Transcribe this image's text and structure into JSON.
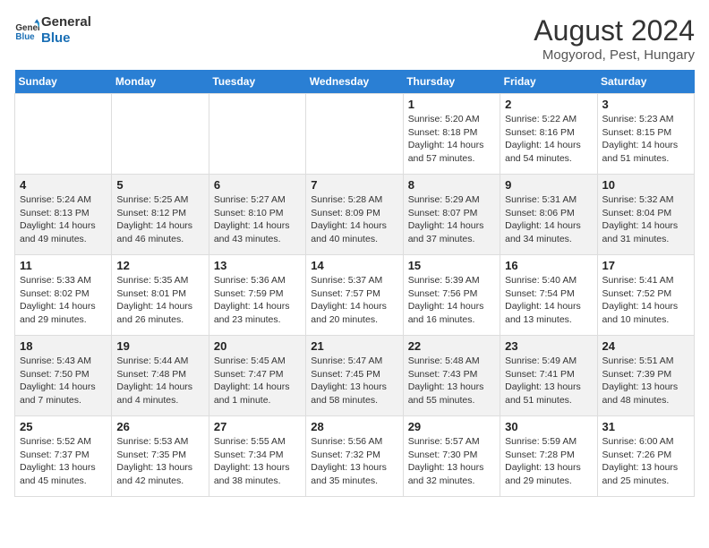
{
  "logo": {
    "text_general": "General",
    "text_blue": "Blue"
  },
  "title": "August 2024",
  "subtitle": "Mogyorod, Pest, Hungary",
  "weekdays": [
    "Sunday",
    "Monday",
    "Tuesday",
    "Wednesday",
    "Thursday",
    "Friday",
    "Saturday"
  ],
  "weeks": [
    [
      {
        "day": "",
        "info": ""
      },
      {
        "day": "",
        "info": ""
      },
      {
        "day": "",
        "info": ""
      },
      {
        "day": "",
        "info": ""
      },
      {
        "day": "1",
        "info": "Sunrise: 5:20 AM\nSunset: 8:18 PM\nDaylight: 14 hours\nand 57 minutes."
      },
      {
        "day": "2",
        "info": "Sunrise: 5:22 AM\nSunset: 8:16 PM\nDaylight: 14 hours\nand 54 minutes."
      },
      {
        "day": "3",
        "info": "Sunrise: 5:23 AM\nSunset: 8:15 PM\nDaylight: 14 hours\nand 51 minutes."
      }
    ],
    [
      {
        "day": "4",
        "info": "Sunrise: 5:24 AM\nSunset: 8:13 PM\nDaylight: 14 hours\nand 49 minutes."
      },
      {
        "day": "5",
        "info": "Sunrise: 5:25 AM\nSunset: 8:12 PM\nDaylight: 14 hours\nand 46 minutes."
      },
      {
        "day": "6",
        "info": "Sunrise: 5:27 AM\nSunset: 8:10 PM\nDaylight: 14 hours\nand 43 minutes."
      },
      {
        "day": "7",
        "info": "Sunrise: 5:28 AM\nSunset: 8:09 PM\nDaylight: 14 hours\nand 40 minutes."
      },
      {
        "day": "8",
        "info": "Sunrise: 5:29 AM\nSunset: 8:07 PM\nDaylight: 14 hours\nand 37 minutes."
      },
      {
        "day": "9",
        "info": "Sunrise: 5:31 AM\nSunset: 8:06 PM\nDaylight: 14 hours\nand 34 minutes."
      },
      {
        "day": "10",
        "info": "Sunrise: 5:32 AM\nSunset: 8:04 PM\nDaylight: 14 hours\nand 31 minutes."
      }
    ],
    [
      {
        "day": "11",
        "info": "Sunrise: 5:33 AM\nSunset: 8:02 PM\nDaylight: 14 hours\nand 29 minutes."
      },
      {
        "day": "12",
        "info": "Sunrise: 5:35 AM\nSunset: 8:01 PM\nDaylight: 14 hours\nand 26 minutes."
      },
      {
        "day": "13",
        "info": "Sunrise: 5:36 AM\nSunset: 7:59 PM\nDaylight: 14 hours\nand 23 minutes."
      },
      {
        "day": "14",
        "info": "Sunrise: 5:37 AM\nSunset: 7:57 PM\nDaylight: 14 hours\nand 20 minutes."
      },
      {
        "day": "15",
        "info": "Sunrise: 5:39 AM\nSunset: 7:56 PM\nDaylight: 14 hours\nand 16 minutes."
      },
      {
        "day": "16",
        "info": "Sunrise: 5:40 AM\nSunset: 7:54 PM\nDaylight: 14 hours\nand 13 minutes."
      },
      {
        "day": "17",
        "info": "Sunrise: 5:41 AM\nSunset: 7:52 PM\nDaylight: 14 hours\nand 10 minutes."
      }
    ],
    [
      {
        "day": "18",
        "info": "Sunrise: 5:43 AM\nSunset: 7:50 PM\nDaylight: 14 hours\nand 7 minutes."
      },
      {
        "day": "19",
        "info": "Sunrise: 5:44 AM\nSunset: 7:48 PM\nDaylight: 14 hours\nand 4 minutes."
      },
      {
        "day": "20",
        "info": "Sunrise: 5:45 AM\nSunset: 7:47 PM\nDaylight: 14 hours\nand 1 minute."
      },
      {
        "day": "21",
        "info": "Sunrise: 5:47 AM\nSunset: 7:45 PM\nDaylight: 13 hours\nand 58 minutes."
      },
      {
        "day": "22",
        "info": "Sunrise: 5:48 AM\nSunset: 7:43 PM\nDaylight: 13 hours\nand 55 minutes."
      },
      {
        "day": "23",
        "info": "Sunrise: 5:49 AM\nSunset: 7:41 PM\nDaylight: 13 hours\nand 51 minutes."
      },
      {
        "day": "24",
        "info": "Sunrise: 5:51 AM\nSunset: 7:39 PM\nDaylight: 13 hours\nand 48 minutes."
      }
    ],
    [
      {
        "day": "25",
        "info": "Sunrise: 5:52 AM\nSunset: 7:37 PM\nDaylight: 13 hours\nand 45 minutes."
      },
      {
        "day": "26",
        "info": "Sunrise: 5:53 AM\nSunset: 7:35 PM\nDaylight: 13 hours\nand 42 minutes."
      },
      {
        "day": "27",
        "info": "Sunrise: 5:55 AM\nSunset: 7:34 PM\nDaylight: 13 hours\nand 38 minutes."
      },
      {
        "day": "28",
        "info": "Sunrise: 5:56 AM\nSunset: 7:32 PM\nDaylight: 13 hours\nand 35 minutes."
      },
      {
        "day": "29",
        "info": "Sunrise: 5:57 AM\nSunset: 7:30 PM\nDaylight: 13 hours\nand 32 minutes."
      },
      {
        "day": "30",
        "info": "Sunrise: 5:59 AM\nSunset: 7:28 PM\nDaylight: 13 hours\nand 29 minutes."
      },
      {
        "day": "31",
        "info": "Sunrise: 6:00 AM\nSunset: 7:26 PM\nDaylight: 13 hours\nand 25 minutes."
      }
    ]
  ]
}
